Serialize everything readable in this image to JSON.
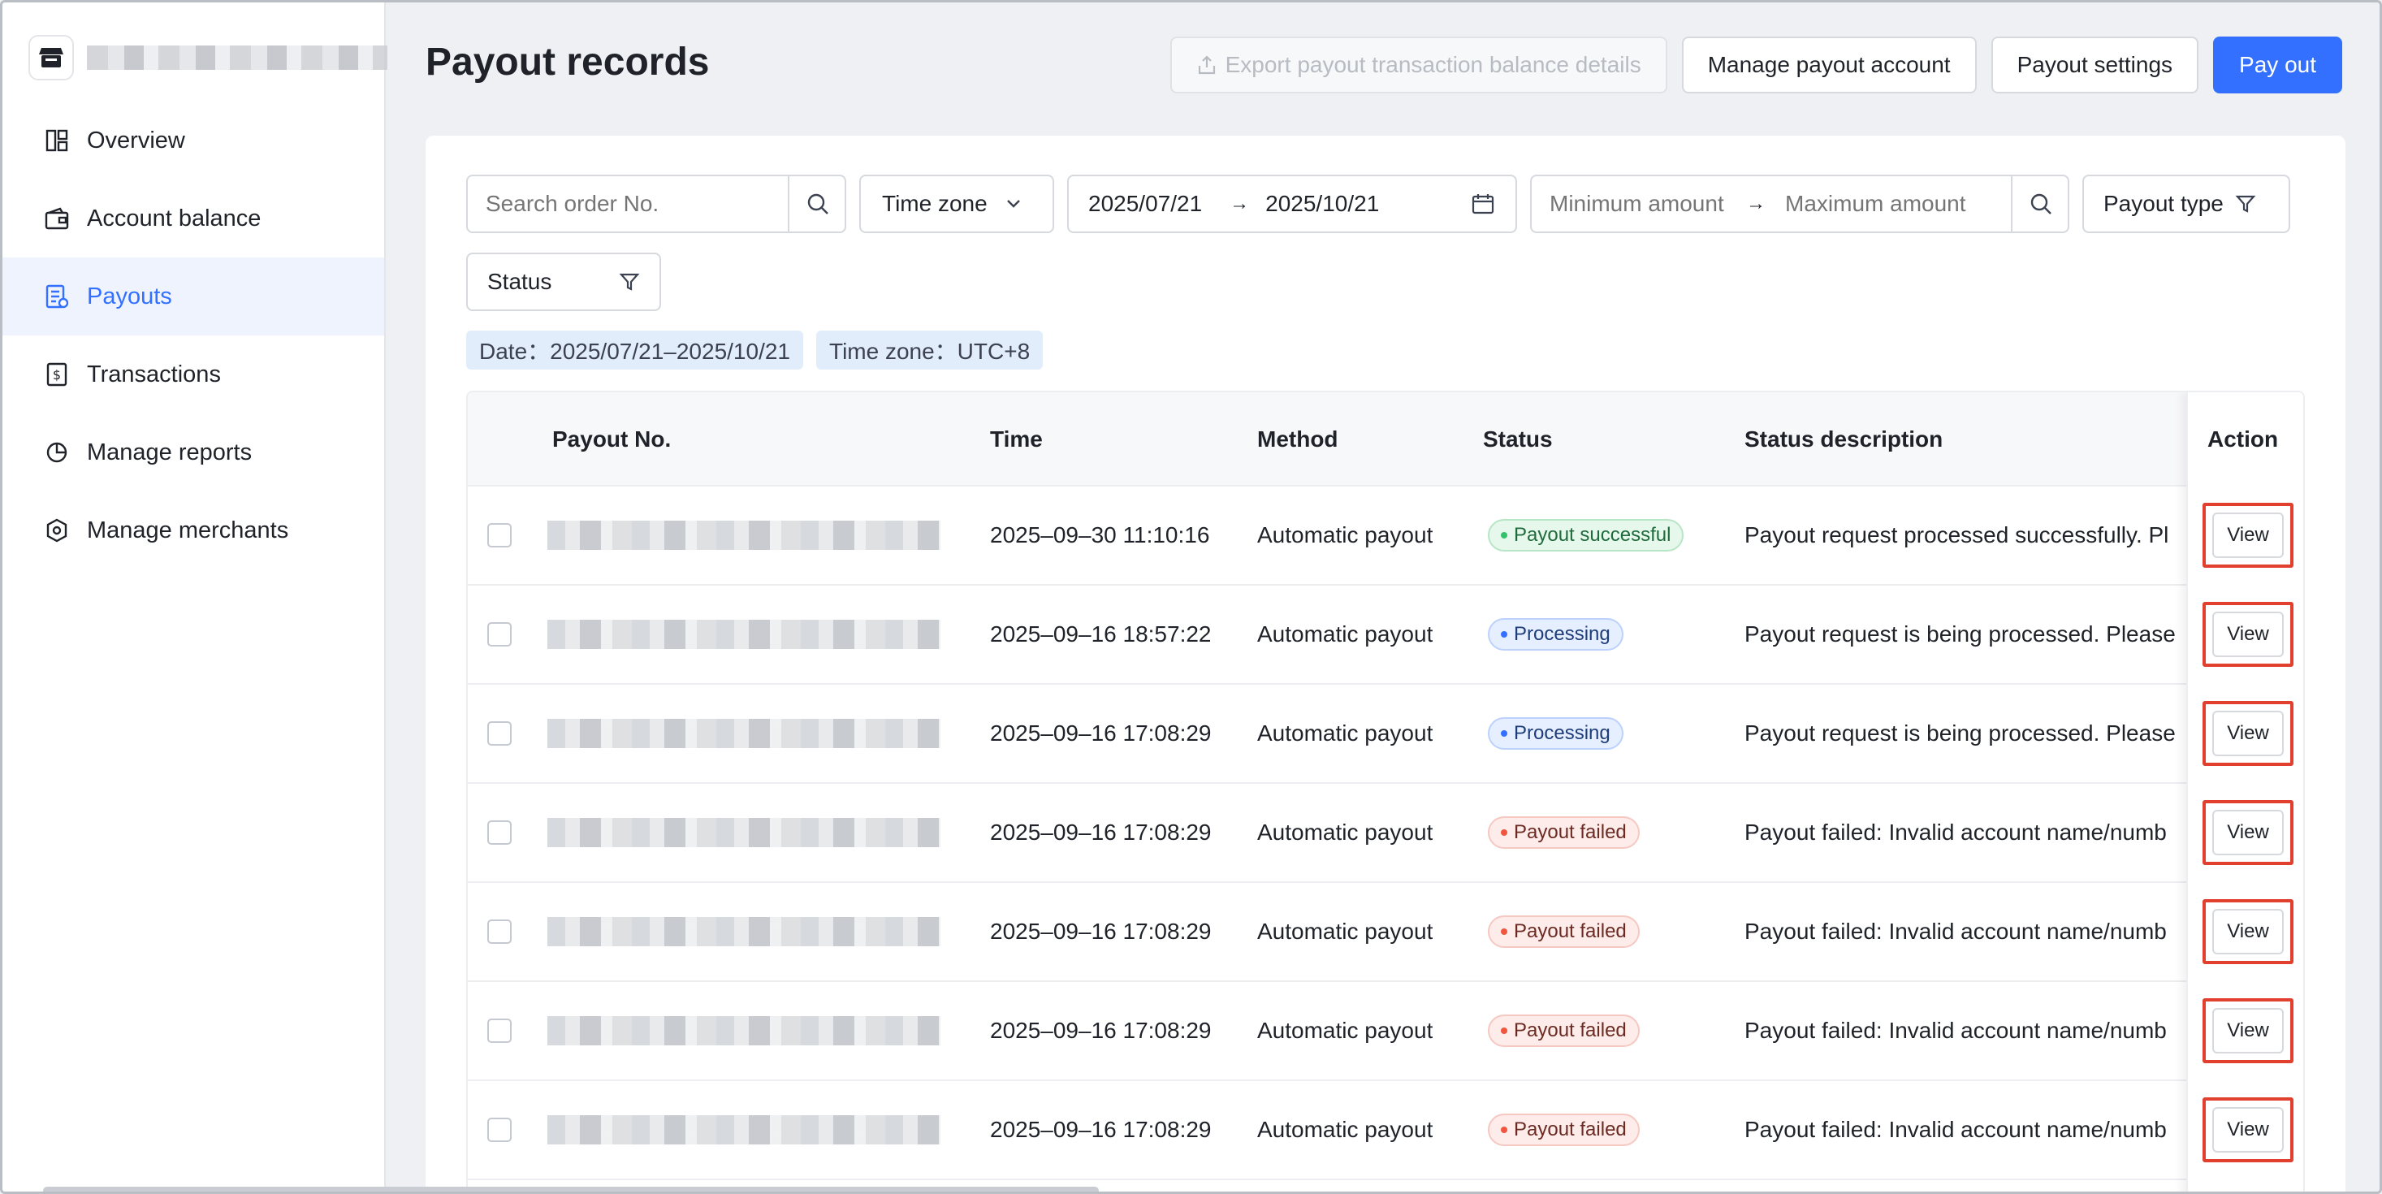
{
  "sidebar": {
    "items": [
      {
        "label": "Overview",
        "icon": "dashboard-icon"
      },
      {
        "label": "Account balance",
        "icon": "wallet-icon"
      },
      {
        "label": "Payouts",
        "icon": "payout-doc-icon",
        "active": true
      },
      {
        "label": "Transactions",
        "icon": "dollar-receipt-icon"
      },
      {
        "label": "Manage reports",
        "icon": "pie-chart-icon"
      },
      {
        "label": "Manage merchants",
        "icon": "hexagon-icon"
      }
    ]
  },
  "header": {
    "title": "Payout records",
    "export_label": "Export payout transaction balance details",
    "manage_account_label": "Manage payout account",
    "settings_label": "Payout settings",
    "payout_label": "Pay out"
  },
  "filters": {
    "search_placeholder": "Search order No.",
    "timezone_label": "Time zone",
    "date_start": "2025/07/21",
    "date_end": "2025/10/21",
    "date_sep": "→",
    "min_amount_placeholder": "Minimum amount",
    "max_amount_placeholder": "Maximum amount",
    "payout_type_label": "Payout type",
    "status_label": "Status"
  },
  "tags": {
    "date": "Date：2025/07/21–2025/10/21",
    "timezone": "Time zone：UTC+8"
  },
  "table": {
    "columns": {
      "payout_no": "Payout No.",
      "time": "Time",
      "method": "Method",
      "status": "Status",
      "status_desc": "Status description",
      "action": "Action"
    },
    "rows": [
      {
        "time": "2025–09–30 11:10:16",
        "method": "Automatic payout",
        "status": "Payout successful",
        "status_kind": "success",
        "desc": "Payout request processed successfully. Pl",
        "action": "View"
      },
      {
        "time": "2025–09–16 18:57:22",
        "method": "Automatic payout",
        "status": "Processing",
        "status_kind": "processing",
        "desc": "Payout request is being processed. Please",
        "action": "View"
      },
      {
        "time": "2025–09–16 17:08:29",
        "method": "Automatic payout",
        "status": "Processing",
        "status_kind": "processing",
        "desc": "Payout request is being processed. Please",
        "action": "View"
      },
      {
        "time": "2025–09–16 17:08:29",
        "method": "Automatic payout",
        "status": "Payout failed",
        "status_kind": "failed",
        "desc": "Payout failed: Invalid account name/numb",
        "action": "View"
      },
      {
        "time": "2025–09–16 17:08:29",
        "method": "Automatic payout",
        "status": "Payout failed",
        "status_kind": "failed",
        "desc": "Payout failed: Invalid account name/numb",
        "action": "View"
      },
      {
        "time": "2025–09–16 17:08:29",
        "method": "Automatic payout",
        "status": "Payout failed",
        "status_kind": "failed",
        "desc": "Payout failed: Invalid account name/numb",
        "action": "View"
      },
      {
        "time": "2025–09–16 17:08:29",
        "method": "Automatic payout",
        "status": "Payout failed",
        "status_kind": "failed",
        "desc": "Payout failed: Invalid account name/numb",
        "action": "View"
      }
    ]
  },
  "colors": {
    "accent": "#3370ff",
    "highlight_box": "#e1402e",
    "success": "#34c16c",
    "failed": "#f0553f"
  }
}
